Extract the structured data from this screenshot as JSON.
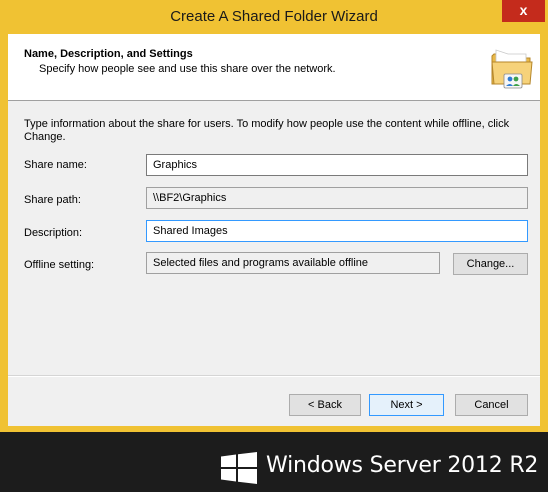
{
  "window": {
    "title": "Create A Shared Folder Wizard",
    "close_glyph": "x"
  },
  "header": {
    "title": "Name, Description, and Settings",
    "subtitle": "Specify how people see and use this share over the network.",
    "icon": "shared-folder-icon"
  },
  "intro_text": "Type information about the share for users. To modify how people use the content while offline, click Change.",
  "fields": {
    "share_name": {
      "label": "Share name:",
      "value": "Graphics"
    },
    "share_path": {
      "label": "Share path:",
      "value": "\\\\BF2\\Graphics"
    },
    "description": {
      "label": "Description:",
      "value": "Shared Images"
    },
    "offline_setting": {
      "label": "Offline setting:",
      "value": "Selected files and programs available offline"
    }
  },
  "buttons": {
    "change": "Change...",
    "back": "< Back",
    "next": "Next >",
    "cancel": "Cancel"
  },
  "branding": {
    "text": "Windows Server 2012 R2",
    "logo_icon": "windows-logo-icon"
  },
  "colors": {
    "title_bar": "#f0c233",
    "close_button": "#c42b1c",
    "focus_border": "#3399ff",
    "brand_background": "#1c1c1c"
  }
}
